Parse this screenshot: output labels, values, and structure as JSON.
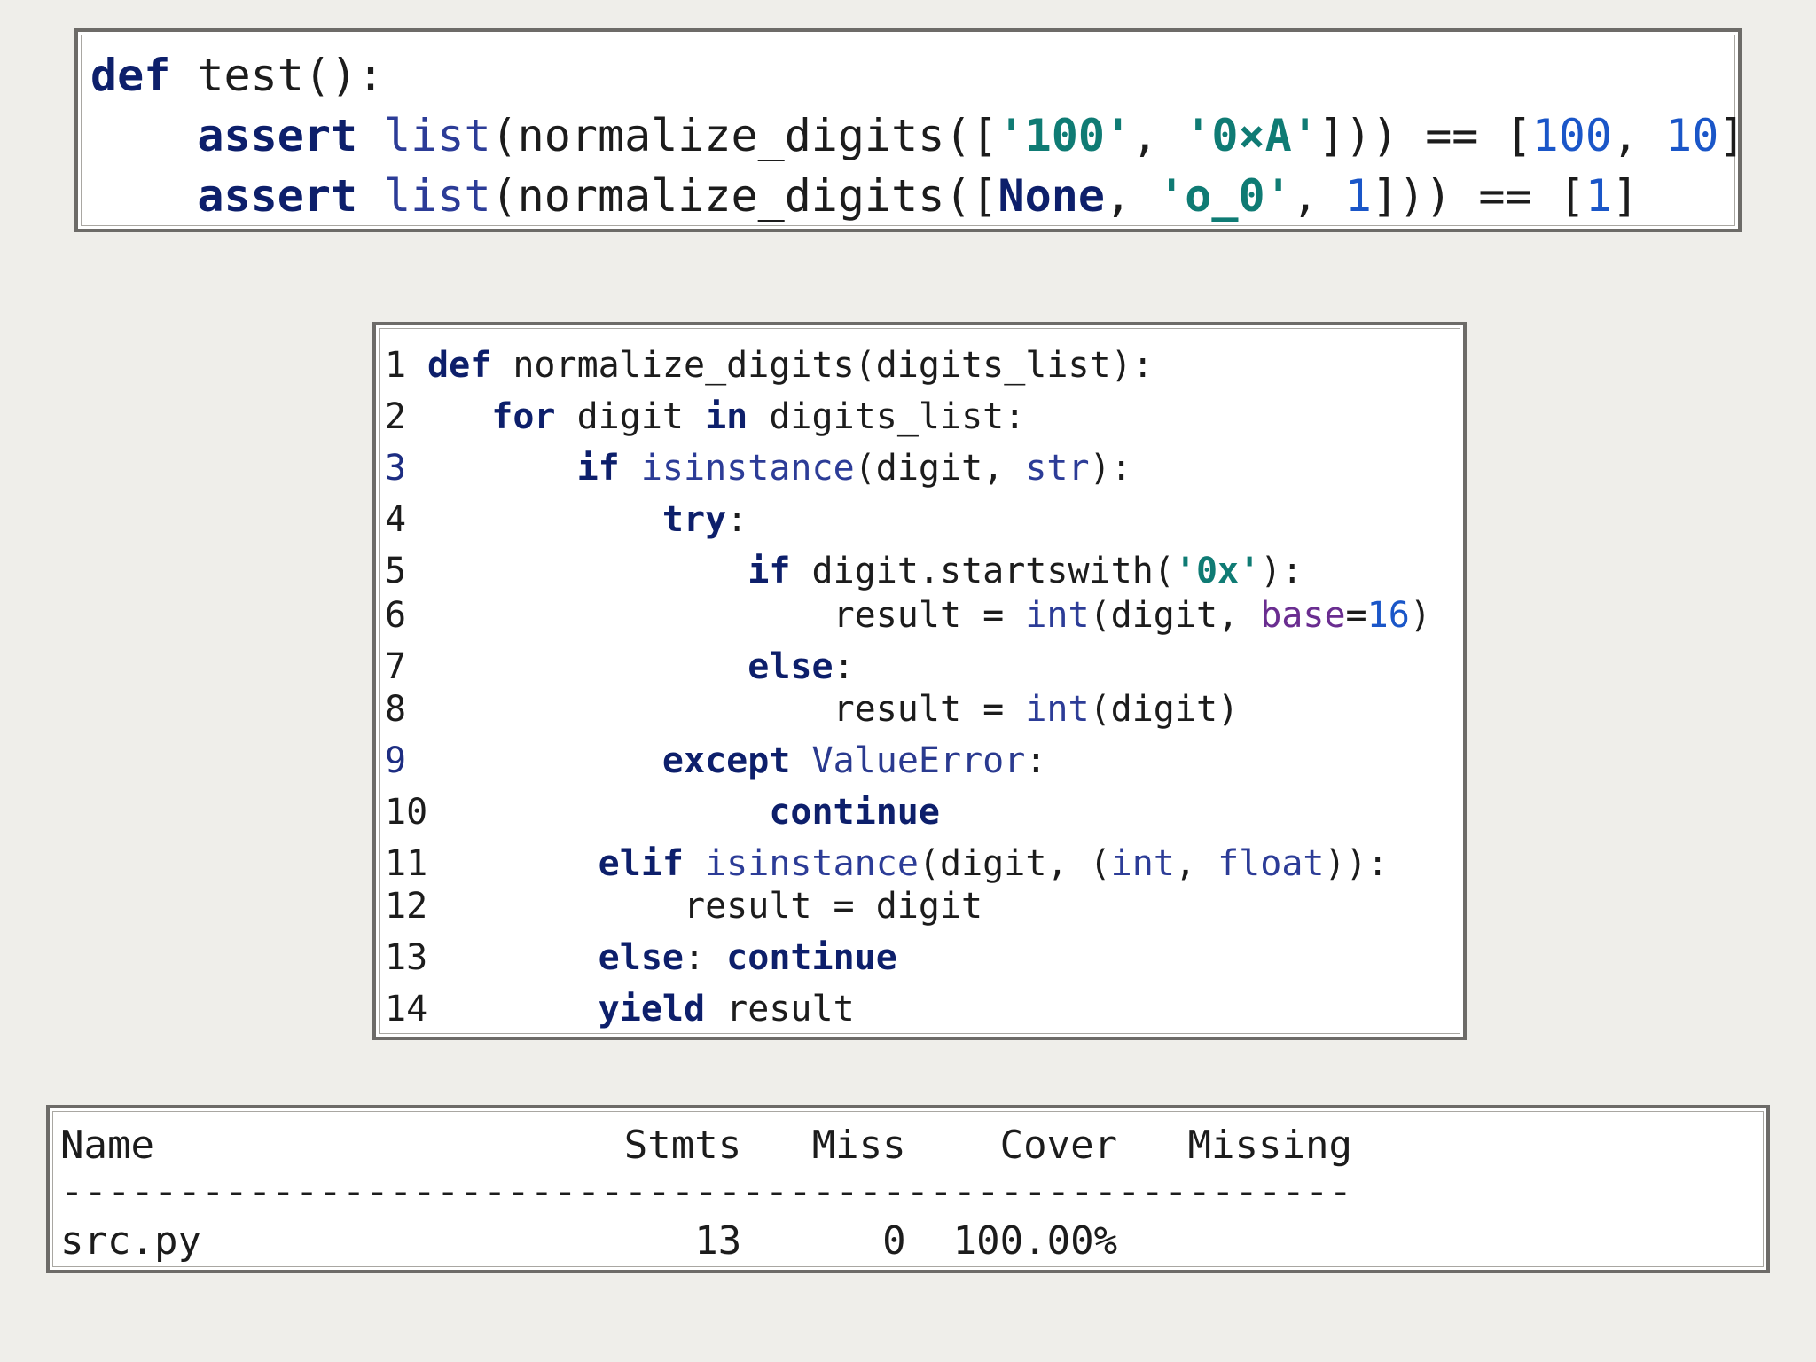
{
  "test_block": {
    "line1": {
      "kw": "def",
      "rest": " test():"
    },
    "line2": {
      "indent": "    ",
      "kw": "assert",
      "sp": " ",
      "fn": "list",
      "a": "(normalize_digits([",
      "s1": "'100'",
      "c1": ", ",
      "s2": "'0×A'",
      "b": "])) == [",
      "n1": "100",
      "c2": ", ",
      "n2": "10",
      "e": "]"
    },
    "line3": {
      "indent": "    ",
      "kw": "assert",
      "sp": " ",
      "fn": "list",
      "a": "(normalize_digits([",
      "none": "None",
      "c1": ", ",
      "s1": "'o_0'",
      "c2": ", ",
      "n1": "1",
      "b": "])) == [",
      "n2": "1",
      "e": "]"
    }
  },
  "code_block": {
    "lines": [
      {
        "n": "1",
        "i": "",
        "k": "def",
        "t": " normalize_digits(digits_list):"
      },
      {
        "n": "2",
        "i": "   ",
        "k": "for",
        "t1": " digit ",
        "k2": "in",
        "t2": " digits_list:"
      },
      {
        "n": "3",
        "i": "       ",
        "k": "if",
        "sp": " ",
        "f": "isinstance",
        "t1": "(digit, ",
        "f2": "str",
        "t2": "):"
      },
      {
        "n": "4",
        "i": "           ",
        "k": "try",
        "t": ":"
      },
      {
        "n": "5",
        "i": "               ",
        "k": "if",
        "t1": " digit.startswith(",
        "s": "'0x'",
        "t2": "):"
      },
      {
        "n": "6",
        "i": "                   ",
        "t1": "result = ",
        "f": "int",
        "t2": "(digit, ",
        "p": "base",
        "eq": "=",
        "num": "16",
        "t3": ")"
      },
      {
        "n": "7",
        "i": "               ",
        "k": "else",
        "t": ":"
      },
      {
        "n": "8",
        "i": "                   ",
        "t1": "result = ",
        "f": "int",
        "t2": "(digit)"
      },
      {
        "n": "9",
        "i": "           ",
        "k": "except",
        "sp": " ",
        "x": "ValueError",
        "t": ":"
      },
      {
        "n": "10",
        "i": "                ",
        "k": "continue"
      },
      {
        "n": "11",
        "i": "        ",
        "k": "elif",
        "sp": " ",
        "f": "isinstance",
        "t1": "(digit, (",
        "f2": "int",
        "c": ", ",
        "f3": "float",
        "t2": ")):"
      },
      {
        "n": "12",
        "i": "            ",
        "t": "result = digit"
      },
      {
        "n": "13",
        "i": "        ",
        "k": "else",
        "t": ": ",
        "k2": "continue"
      },
      {
        "n": "14",
        "i": "        ",
        "k": "yield",
        "t": " result"
      }
    ]
  },
  "coverage": {
    "header": "Name                    Stmts   Miss    Cover   Missing",
    "divider": "-------------------------------------------------------",
    "row": "src.py                     13      0  100.00%"
  }
}
